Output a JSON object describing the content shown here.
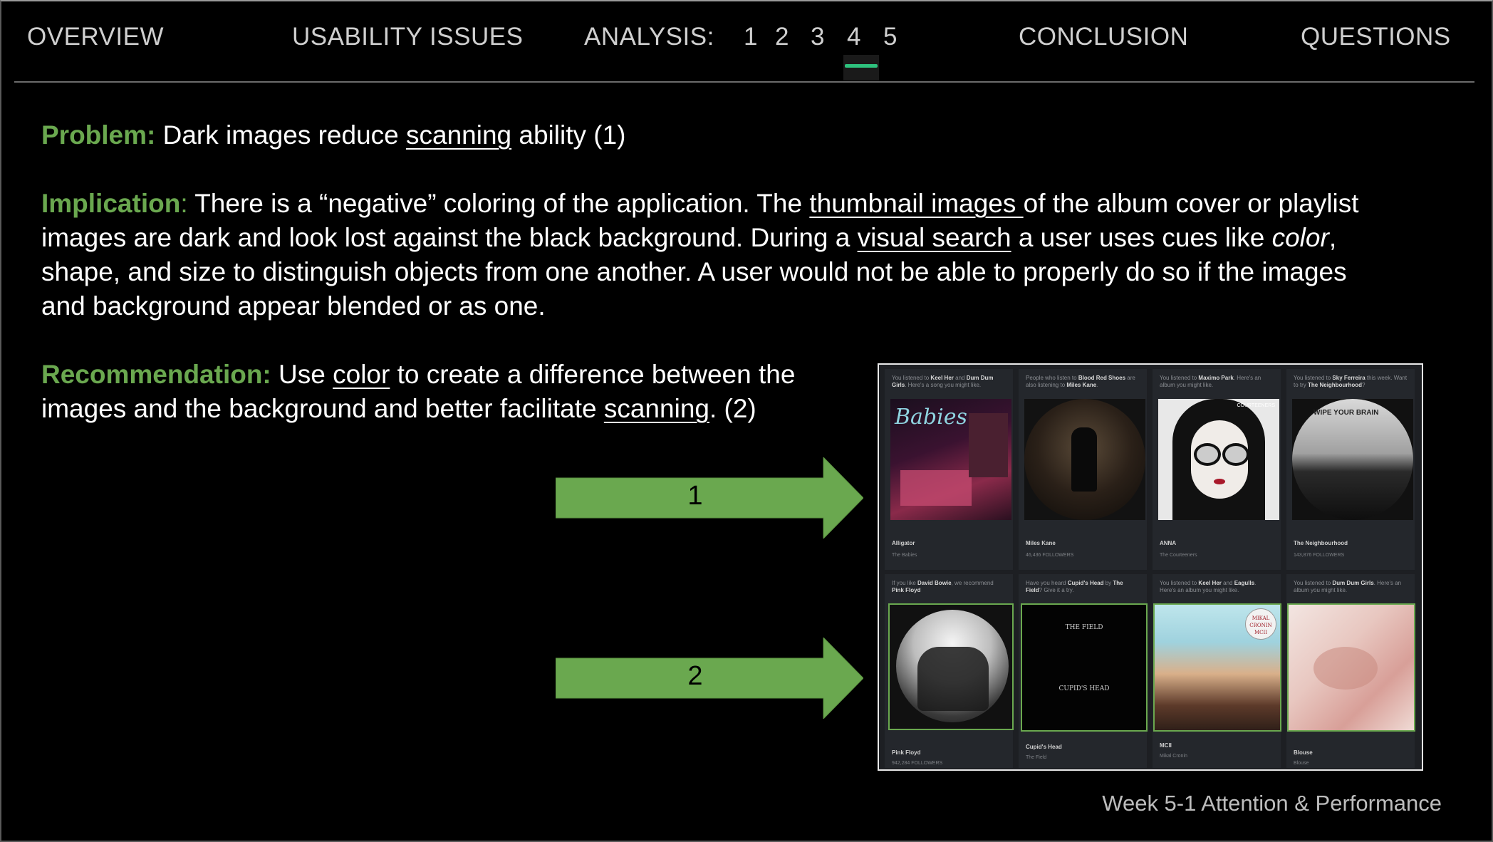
{
  "nav": {
    "overview": "OVERVIEW",
    "usability": "USABILITY ISSUES",
    "analysis_label": "ANALYSIS:",
    "pages": [
      "1",
      "2",
      "3",
      "4",
      "5"
    ],
    "active_page": "4",
    "conclusion": "CONCLUSION",
    "questions": "QUESTIONS"
  },
  "problem": {
    "label": "Problem:",
    "pre": " Dark images reduce ",
    "link": "scanning",
    "post": " ability (1)"
  },
  "implication": {
    "label": "Implication",
    "colon": ":",
    "t1": " There is a “negative” coloring of the application. The ",
    "link1": "thumbnail images ",
    "t2": "of the album cover or playlist images are dark and look lost against the black background. During a ",
    "link2": "visual search",
    "t3": " a user uses cues like ",
    "em": "color",
    "t4": ", shape, and size to distinguish objects from one another. A user would not be able to properly do so if the images and background appear blended or as one."
  },
  "recommendation": {
    "label": "Recommendation:",
    "t1": " Use ",
    "link1": "color",
    "t2": " to create a difference between the images and the background and better facilitate ",
    "link2": "scanning",
    "t3": ". (2)"
  },
  "arrows": [
    "1",
    "2"
  ],
  "screenshot": {
    "row1": [
      {
        "cap_pre": "You listened to ",
        "cap_b1": "Keel Her",
        "cap_mid": " and ",
        "cap_b2": "Dum Dum Girls",
        "cap_post": ". Here's a song you might like.",
        "title": "Alligator",
        "sub": "The Babies",
        "art_text": "Babies"
      },
      {
        "cap_pre": "People who listen to ",
        "cap_b1": "Blood Red Shoes",
        "cap_mid": " are also listening to ",
        "cap_b2": "Miles Kane",
        "cap_post": ".",
        "title": "Miles Kane",
        "sub": "46,436 FOLLOWERS",
        "art_text": ""
      },
      {
        "cap_pre": "You listened to ",
        "cap_b1": "Maximo Park",
        "cap_mid": ". Here's an album you might like.",
        "cap_b2": "",
        "cap_post": "",
        "title": "ANNA",
        "sub": "The Courteeners",
        "art_text": "COURTEENERS"
      },
      {
        "cap_pre": "You listened to ",
        "cap_b1": "Sky Ferreira",
        "cap_mid": " this week. Want to try ",
        "cap_b2": "The Neighbourhood",
        "cap_post": "?",
        "title": "The Neighbourhood",
        "sub": "143,876 FOLLOWERS",
        "art_text": "WIPE YOUR BRAIN"
      }
    ],
    "row2": [
      {
        "cap_pre": "If you like ",
        "cap_b1": "David Bowie",
        "cap_mid": ", we recommend ",
        "cap_b2": "Pink Floyd",
        "cap_post": "",
        "title": "Pink Floyd",
        "sub": "942,284 FOLLOWERS",
        "art_text": ""
      },
      {
        "cap_pre": "Have you heard ",
        "cap_b1": "Cupid's Head",
        "cap_mid": " by ",
        "cap_b2": "The Field",
        "cap_post": "? Give it a try.",
        "title": "Cupid's Head",
        "sub": "The Field",
        "art_text1": "THE FIELD",
        "art_text2": "CUPID'S HEAD"
      },
      {
        "cap_pre": "You listened to ",
        "cap_b1": "Keel Her",
        "cap_mid": " and ",
        "cap_b2": "Eagulls",
        "cap_post": ". Here's an album you might like.",
        "title": "MCII",
        "sub": "Mikal Cronin",
        "art_text": "MIKAL CRONIN MCII"
      },
      {
        "cap_pre": "You listened to ",
        "cap_b1": "Dum Dum Girls",
        "cap_mid": ". Here's an album you might like.",
        "cap_b2": "",
        "cap_post": "",
        "title": "Blouse",
        "sub": "Blouse",
        "art_text": ""
      }
    ]
  },
  "footer": "Week 5-1 Attention & Performance",
  "colors": {
    "accent_green": "#6aa84f",
    "active_tab": "#2ec27e",
    "background": "#000000"
  }
}
